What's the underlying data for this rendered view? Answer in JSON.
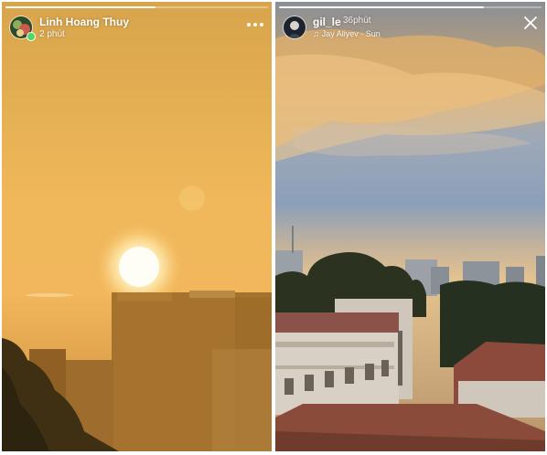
{
  "stories": {
    "left": {
      "user_name": "Linh Hoang Thuy",
      "time_ago": "2 phút",
      "progress": 0.57,
      "icons": {
        "avatar": "avatar-image",
        "online": "online-dot",
        "more": "more-options-icon"
      },
      "colors": {
        "online_dot": "#4cd964"
      }
    },
    "right": {
      "user_name": "gil_le",
      "time_ago": "36phút",
      "music": "Jay Aliyev · Sun",
      "progress": 0.78,
      "icons": {
        "avatar": "avatar-image",
        "music": "music-note-icon",
        "close": "close-icon"
      }
    }
  }
}
